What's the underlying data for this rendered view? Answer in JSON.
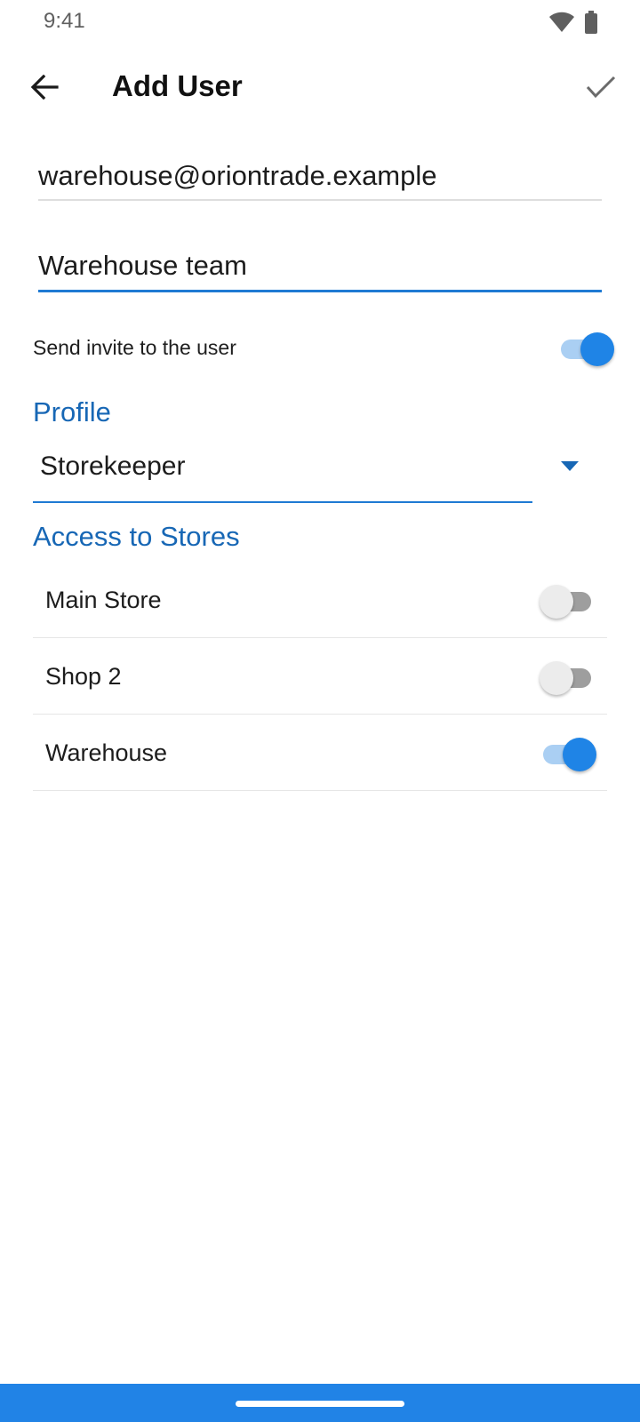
{
  "status_bar": {
    "time": "9:41",
    "icons": [
      "wifi-icon",
      "battery-icon"
    ]
  },
  "app_bar": {
    "title": "Add User",
    "back_icon": "arrow-left-icon",
    "confirm_icon": "checkmark-icon"
  },
  "form": {
    "email": {
      "value": "warehouse@oriontrade.example"
    },
    "name": {
      "value": "Warehouse team",
      "focused": true
    },
    "send_invite": {
      "label": "Send invite to the user",
      "enabled": true
    }
  },
  "profile": {
    "section_title": "Profile",
    "selected": "Storekeeper"
  },
  "stores": {
    "section_title": "Access to Stores",
    "items": [
      {
        "name": "Main Store",
        "enabled": false
      },
      {
        "name": "Shop 2",
        "enabled": false
      },
      {
        "name": "Warehouse",
        "enabled": true
      }
    ]
  },
  "colors": {
    "accent": "#1f84e6",
    "section_title": "#1767b5",
    "nav_bar": "#2183e6"
  }
}
